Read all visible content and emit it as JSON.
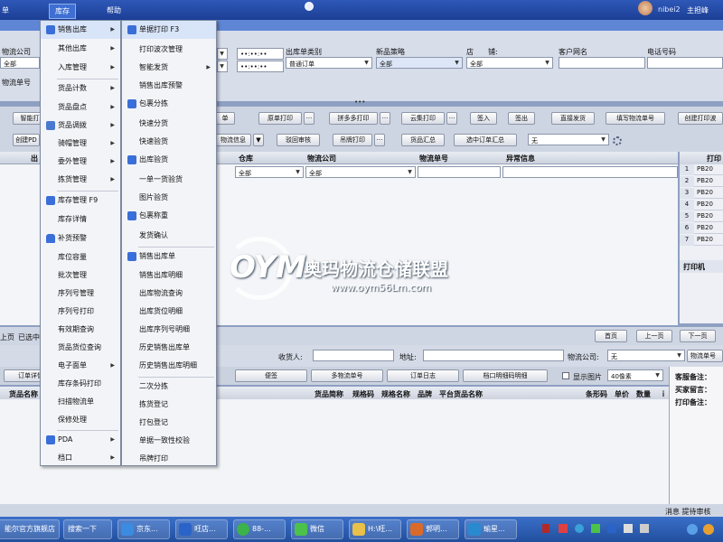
{
  "menubar": {
    "items": [
      "单",
      "库存",
      "帮助"
    ],
    "user": "nibei2",
    "status": "主担峰"
  },
  "filters": {
    "logistics_label": "物流公司",
    "logistics_value": "全部",
    "order_type_label": "出库单类别",
    "order_type_value": "普通订单",
    "new_product_label": "新品策略",
    "new_product_value": "全部",
    "store_label": "店　　铺:",
    "store_value": "全部",
    "customer_label": "客户网名",
    "phone_label": "电话号码",
    "waybill_label": "物流单号",
    "time_value": "••:••:••"
  },
  "toolbar": {
    "row1": [
      "智能打",
      "单",
      "原单打印",
      "拼多多打印",
      "云集打印",
      "签入",
      "签出",
      "直接发货",
      "填写物流单号",
      "创建打印波"
    ],
    "row2": [
      "创建PD",
      "物流信息",
      "驳回审核",
      "吊牌打印",
      "货品汇总",
      "选中订单汇总"
    ],
    "row2_select": "无"
  },
  "grid": {
    "headers": [
      "出",
      "仓库",
      "物流公司",
      "物流单号",
      "异常信息"
    ],
    "filter_values": [
      "全部",
      "全部"
    ]
  },
  "right_panel": {
    "header": "打印",
    "rows": [
      {
        "n": "1",
        "v": "PB20"
      },
      {
        "n": "2",
        "v": "PB20"
      },
      {
        "n": "3",
        "v": "PB20"
      },
      {
        "n": "4",
        "v": "PB20"
      },
      {
        "n": "5",
        "v": "PB20"
      },
      {
        "n": "6",
        "v": "PB20"
      },
      {
        "n": "7",
        "v": "PB20"
      }
    ],
    "printer_label": "打印机"
  },
  "pager": {
    "left_text": "上页",
    "selected": "已选中",
    "first": "首页",
    "prev": "上一页",
    "next": "下一页"
  },
  "filter2": {
    "receiver_label": "收货人:",
    "address_label": "地址:",
    "logistics_label": "物流公司:",
    "logistics_value": "无",
    "waybill_label": "物流单号"
  },
  "tabs": {
    "items": [
      "订单详情",
      "便签",
      "多物流单号",
      "订单日志",
      "档口明细码明细"
    ],
    "show_image_label": "显示图片",
    "image_size": "40像素"
  },
  "lower_cols": [
    "货品名称",
    "货品简称",
    "规格码",
    "规格名称",
    "品牌",
    "平台货品名称",
    "条形码",
    "单价",
    "数量",
    "ｉ"
  ],
  "remarks": [
    "客服备注：",
    "买家留言：",
    "打印备注："
  ],
  "status": "消息 提待审核",
  "taskbar": {
    "items": [
      "能尔官方旗舰店",
      "搜索一下",
      "京东...",
      "旺店...",
      "88-...",
      "微信",
      "H:\\旺...",
      "郭明...",
      "瑜星..."
    ]
  },
  "menu1": {
    "items": [
      {
        "label": "销售出库",
        "arrow": true,
        "icon": "home"
      },
      {
        "label": "其他出库",
        "arrow": true
      },
      {
        "label": "入库管理",
        "arrow": true
      },
      {
        "label": "货品计数",
        "arrow": true
      },
      {
        "label": "货品盘点",
        "arrow": true
      },
      {
        "label": "货品调拨",
        "arrow": true,
        "icon": "doc"
      },
      {
        "label": "骑帽管理",
        "arrow": true
      },
      {
        "label": "委外管理",
        "arrow": true
      },
      {
        "label": "拣货管理",
        "arrow": true
      },
      {
        "label": "库存管理 F9",
        "icon": "box"
      },
      {
        "label": "库存详情"
      },
      {
        "label": "补货预警",
        "icon": "lock"
      },
      {
        "label": "库位容量"
      },
      {
        "label": "批次管理"
      },
      {
        "label": "序列号管理"
      },
      {
        "label": "序列号打印"
      },
      {
        "label": "有效期查询"
      },
      {
        "label": "货品货位查询"
      },
      {
        "label": "电子面单",
        "arrow": true
      },
      {
        "label": "库存条码打印"
      },
      {
        "label": "扫描物流单"
      },
      {
        "label": "保修处理"
      },
      {
        "label": "PDA",
        "arrow": true,
        "icon": "pda"
      },
      {
        "label": "档口",
        "arrow": true
      }
    ]
  },
  "menu2": {
    "items": [
      {
        "label": "单据打印 F3",
        "icon": "print"
      },
      {
        "label": "打印波次管理"
      },
      {
        "label": "智能发货",
        "arrow": true
      },
      {
        "label": "销售出库预警"
      },
      {
        "label": "包裹分拣",
        "icon": "pack"
      },
      {
        "label": "快速分货"
      },
      {
        "label": "快速验货"
      },
      {
        "label": "出库验货",
        "icon": "check"
      },
      {
        "label": "一单一货验货"
      },
      {
        "label": "图片验货"
      },
      {
        "label": "包裹称重",
        "icon": "scale"
      },
      {
        "label": "发货确认"
      },
      {
        "label": "销售出库单",
        "icon": "list"
      },
      {
        "label": "销售出库明细"
      },
      {
        "label": "出库物流查询"
      },
      {
        "label": "出库货位明细"
      },
      {
        "label": "出库序列号明细"
      },
      {
        "label": "历史销售出库单"
      },
      {
        "label": "历史销售出库明细"
      },
      {
        "label": "二次分拣"
      },
      {
        "label": "拣货登记"
      },
      {
        "label": "打包登记"
      },
      {
        "label": "单据一致性校验"
      },
      {
        "label": "吊牌打印"
      }
    ]
  },
  "watermark": {
    "logo": "OYM",
    "cn": "奥玛物流仓储联盟",
    "url": "www.oym56Lm.com"
  }
}
